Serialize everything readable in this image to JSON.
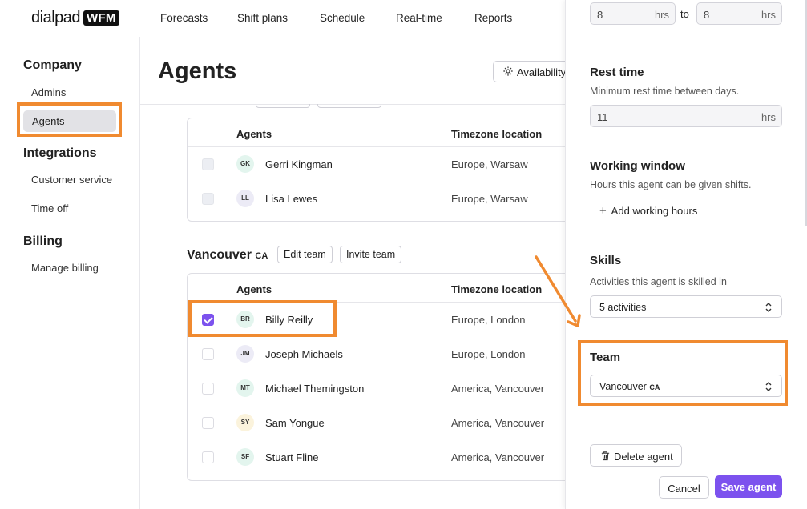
{
  "brand": {
    "name": "dialpad",
    "badge": "WFM"
  },
  "nav": [
    "Forecasts",
    "Shift plans",
    "Schedule",
    "Real-time",
    "Reports"
  ],
  "sidebar": {
    "company": "Company",
    "admins": "Admins",
    "agents": "Agents",
    "integrations": "Integrations",
    "customer_service": "Customer service",
    "time_off": "Time off",
    "billing": "Billing",
    "manage_billing": "Manage billing"
  },
  "main": {
    "title": "Agents",
    "availability_button": "Availability",
    "col_agents": "Agents",
    "col_timezone": "Timezone location",
    "team1_rows": [
      {
        "initials": "GK",
        "name": "Gerri Kingman",
        "tz": "Europe, Warsaw"
      },
      {
        "initials": "LL",
        "name": "Lisa Lewes",
        "tz": "Europe, Warsaw"
      }
    ],
    "team2": {
      "name": "Vancouver",
      "suffix": "CA",
      "edit": "Edit team",
      "invite": "Invite team",
      "rows": [
        {
          "initials": "BR",
          "name": "Billy Reilly",
          "tz": "Europe, London"
        },
        {
          "initials": "JM",
          "name": "Joseph Michaels",
          "tz": "Europe, London"
        },
        {
          "initials": "MT",
          "name": "Michael Themingston",
          "tz": "America, Vancouver"
        },
        {
          "initials": "SY",
          "name": "Sam Yongue",
          "tz": "America, Vancouver"
        },
        {
          "initials": "SF",
          "name": "Stuart Fline",
          "tz": "America, Vancouver"
        }
      ]
    }
  },
  "panel": {
    "hours_from": "8",
    "hours_to": "8",
    "hrs": "hrs",
    "to": "to",
    "rest_title": "Rest time",
    "rest_sub": "Minimum rest time between days.",
    "rest_value": "11",
    "window_title": "Working window",
    "window_sub": "Hours this agent can be given shifts.",
    "add_hours": "Add working hours",
    "skills_title": "Skills",
    "skills_sub": "Activities this agent is skilled in",
    "skills_value": "5 activities",
    "team_title": "Team",
    "team_value": "Vancouver",
    "team_suffix": "CA",
    "delete": "Delete agent",
    "cancel": "Cancel",
    "save": "Save agent"
  },
  "colors": {
    "accent": "#7c52ee",
    "highlight": "#f08a30"
  }
}
